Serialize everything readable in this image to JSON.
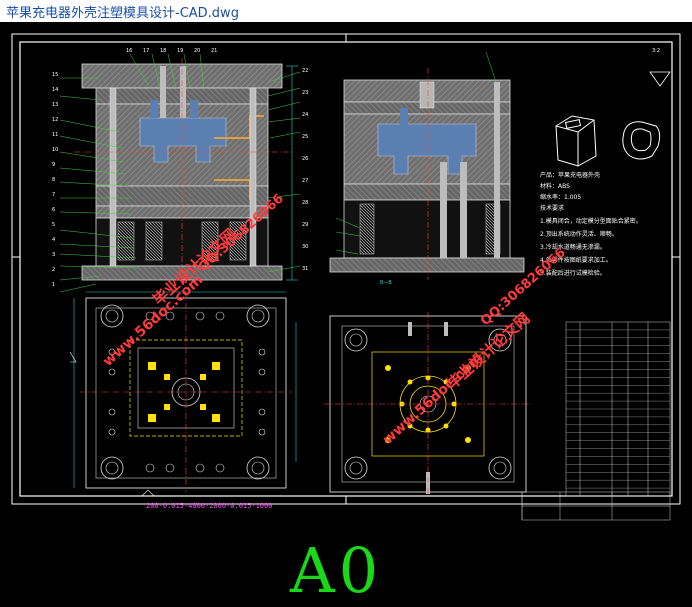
{
  "window": {
    "title": "苹果充电器外壳注塑模具设计-CAD.dwg"
  },
  "drawing": {
    "sheet_size_label": "A0",
    "section_caption": "B—B",
    "tech_notes": [
      "产品：苹果充电器外壳",
      "材料：ABS",
      "缩水率：1.005",
      "技术要求"
    ],
    "note_lines": [
      "1.模具闭合，动定模分型面贴合紧密。",
      "2.顶出系统动作灵活、顺畅。",
      "3.冷却水道畅通无渗漏。",
      "4.各零件按图纸要求加工。",
      "5.装配后进行试模检验。"
    ],
    "dimension_chain": "200-0.015-4000-2000-0.015-1000",
    "part_numbers_left": [
      "15",
      "14",
      "13",
      "12",
      "11",
      "10",
      "9",
      "8",
      "7",
      "6",
      "5",
      "4",
      "3",
      "2",
      "1"
    ],
    "part_numbers_top": [
      "16",
      "17",
      "18",
      "19",
      "20",
      "21"
    ],
    "part_numbers_right": [
      "22",
      "23",
      "24",
      "25",
      "26",
      "27",
      "28",
      "29",
      "30",
      "31"
    ],
    "part_numbers_mid": [
      "35",
      "34",
      "33",
      "32"
    ],
    "scale_label": "3:2",
    "title_block_rows": 22
  },
  "watermark": {
    "site": "www.56doc.com",
    "name": "毕业设计论文网",
    "qq": "QQ:306826066"
  },
  "colors": {
    "background": "#000000",
    "frame": "#ffffff",
    "mold_plates": "#8a8a8a",
    "cavity": "#5a7fb0",
    "runner": "#e0a040",
    "centerline": "#ff4040",
    "ejector": "#ffe000",
    "dimension": "#20d0d0",
    "springs": "#d0d0d0",
    "green_text": "#18d818",
    "magenta_text": "#ff4dff",
    "watermark": "#ff3a3a"
  }
}
